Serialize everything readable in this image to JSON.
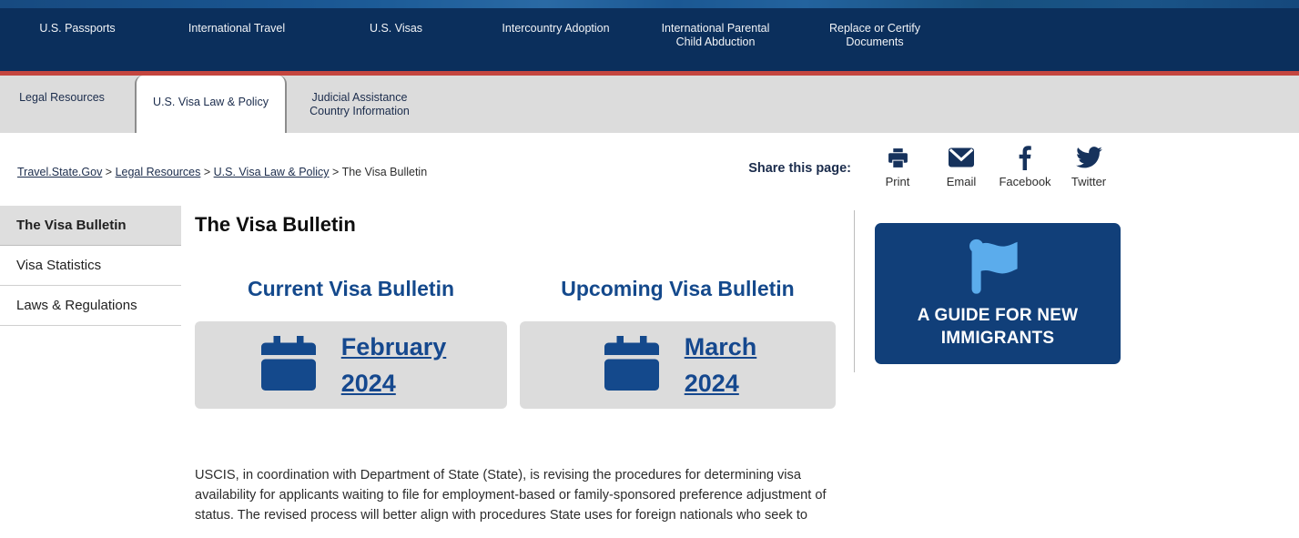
{
  "header": {
    "nav_items": [
      {
        "label": "U.S. Passports"
      },
      {
        "label": "International Travel"
      },
      {
        "label": "U.S. Visas"
      },
      {
        "label": "Intercountry Adoption"
      },
      {
        "label": "International Parental Child Abduction"
      },
      {
        "label": "Replace or Certify Documents"
      }
    ],
    "accent_red": "#c4453f",
    "bg_navy": "#0b2f5c"
  },
  "tabs": [
    {
      "label": "Legal Resources",
      "active": false
    },
    {
      "label": "U.S. Visa Law & Policy",
      "active": true
    },
    {
      "label": "Judicial Assistance Country Information",
      "active": false
    }
  ],
  "breadcrumb": {
    "items": [
      {
        "label": "Travel.State.Gov",
        "link": true
      },
      {
        "label": "Legal Resources",
        "link": true
      },
      {
        "label": "U.S. Visa Law & Policy",
        "link": true
      },
      {
        "label": "The Visa Bulletin",
        "link": false
      }
    ],
    "separator": ">"
  },
  "share": {
    "label": "Share this page:",
    "items": [
      {
        "caption": "Print",
        "icon": "printer-icon"
      },
      {
        "caption": "Email",
        "icon": "envelope-icon"
      },
      {
        "caption": "Facebook",
        "icon": "facebook-icon"
      },
      {
        "caption": "Twitter",
        "icon": "twitter-icon"
      }
    ]
  },
  "sidebar": {
    "items": [
      {
        "label": "The Visa Bulletin",
        "active": true
      },
      {
        "label": "Visa Statistics",
        "active": false
      },
      {
        "label": "Laws & Regulations",
        "active": false
      }
    ]
  },
  "main": {
    "page_title": "The Visa Bulletin",
    "bulletins": [
      {
        "heading": "Current Visa Bulletin",
        "month": "February",
        "year": "2024",
        "icon": "calendar-icon"
      },
      {
        "heading": "Upcoming Visa Bulletin",
        "month": "March",
        "year": "2024",
        "icon": "calendar-icon"
      }
    ],
    "intro_paragraph": "USCIS, in coordination with Department of State (State), is revising the procedures for determining visa availability for applicants waiting to file for employment-based or family-sponsored preference adjustment of status. The revised process will better align with procedures State uses for foreign nationals who seek to"
  },
  "promo": {
    "line1": "A GUIDE FOR NEW",
    "line2": "IMMIGRANTS",
    "icon": "flag-icon",
    "bg_color": "#113f79",
    "flag_color": "#5bacec"
  }
}
